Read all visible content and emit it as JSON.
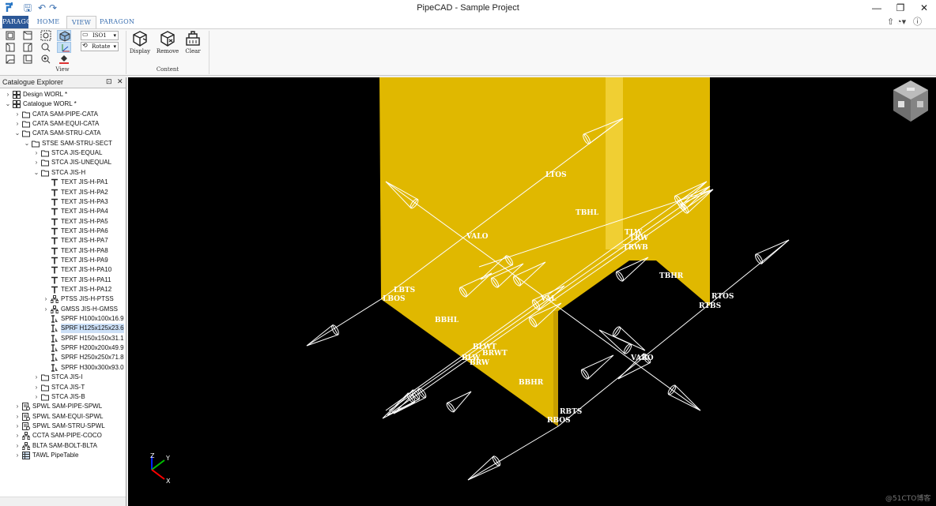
{
  "titlebar": {
    "title": "PipeCAD - Sample Project",
    "minimize": "—",
    "restore": "❐",
    "close": "✕"
  },
  "ribbon": {
    "tabs": [
      {
        "label": "PARAGON"
      },
      {
        "label": "HOME"
      },
      {
        "label": "VIEW"
      },
      {
        "label": "PARAGON"
      }
    ],
    "right_icons": [
      "up-arrow-icon",
      "palette-icon",
      "help-icon"
    ],
    "view_direction_combo": "ISO1",
    "view_mode_combo": "Rotate",
    "buttons": {
      "display": "Display",
      "remove": "Remove",
      "clear": "Clear"
    },
    "groups": {
      "view": "View",
      "content": "Content"
    }
  },
  "explorer": {
    "title": "Catalogue Explorer",
    "pin": "⊡",
    "close": "✕",
    "nodes": [
      {
        "label": "Design WORL *",
        "icon": "database-icon"
      },
      {
        "label": "Catalogue WORL *",
        "icon": "database-icon"
      },
      {
        "label": "CATA SAM-PIPE-CATA",
        "icon": "folder-icon"
      },
      {
        "label": "CATA SAM-EQUI-CATA",
        "icon": "folder-icon"
      },
      {
        "label": "CATA SAM-STRU-CATA",
        "icon": "folder-icon"
      },
      {
        "label": "STSE SAM-STRU-SECT",
        "icon": "folder-icon"
      },
      {
        "label": "STCA JIS-EQUAL",
        "icon": "folder-icon"
      },
      {
        "label": "STCA JIS-UNEQUAL",
        "icon": "folder-icon"
      },
      {
        "label": "STCA JIS-H",
        "icon": "folder-icon"
      },
      {
        "label": "TEXT JIS-H-PA1",
        "icon": "text-icon"
      },
      {
        "label": "TEXT JIS-H-PA2",
        "icon": "text-icon"
      },
      {
        "label": "TEXT JIS-H-PA3",
        "icon": "text-icon"
      },
      {
        "label": "TEXT JIS-H-PA4",
        "icon": "text-icon"
      },
      {
        "label": "TEXT JIS-H-PA5",
        "icon": "text-icon"
      },
      {
        "label": "TEXT JIS-H-PA6",
        "icon": "text-icon"
      },
      {
        "label": "TEXT JIS-H-PA7",
        "icon": "text-icon"
      },
      {
        "label": "TEXT JIS-H-PA8",
        "icon": "text-icon"
      },
      {
        "label": "TEXT JIS-H-PA9",
        "icon": "text-icon"
      },
      {
        "label": "TEXT JIS-H-PA10",
        "icon": "text-icon"
      },
      {
        "label": "TEXT JIS-H-PA11",
        "icon": "text-icon"
      },
      {
        "label": "TEXT JIS-H-PA12",
        "icon": "text-icon"
      },
      {
        "label": "PTSS JIS-H-PTSS",
        "icon": "hierarchy-icon"
      },
      {
        "label": "GMSS JIS-H-GMSS",
        "icon": "hierarchy-icon"
      },
      {
        "label": "SPRF H100x100x16.9",
        "icon": "profile-icon"
      },
      {
        "label": "SPRF H125x125x23.6",
        "icon": "profile-icon"
      },
      {
        "label": "SPRF H150x150x31.1",
        "icon": "profile-icon"
      },
      {
        "label": "SPRF H200x200x49.9",
        "icon": "profile-icon"
      },
      {
        "label": "SPRF H250x250x71.8",
        "icon": "profile-icon"
      },
      {
        "label": "SPRF H300x300x93.0",
        "icon": "profile-icon"
      },
      {
        "label": "STCA JIS-I",
        "icon": "folder-icon"
      },
      {
        "label": "STCA JIS-T",
        "icon": "folder-icon"
      },
      {
        "label": "STCA JIS-B",
        "icon": "folder-icon"
      },
      {
        "label": "SPWL SAM-PIPE-SPWL",
        "icon": "spec-icon"
      },
      {
        "label": "SPWL SAM-EQUI-SPWL",
        "icon": "spec-icon"
      },
      {
        "label": "SPWL SAM-STRU-SPWL",
        "icon": "spec-icon"
      },
      {
        "label": "CCTA SAM-PIPE-COCO",
        "icon": "hierarchy-icon"
      },
      {
        "label": "BLTA SAM-BOLT-BLTA",
        "icon": "hierarchy-icon"
      },
      {
        "label": "TAWL PipeTable",
        "icon": "table-icon"
      }
    ],
    "selected_node": "SPRF H125x125x23.6"
  },
  "viewport": {
    "background": "#000000",
    "profile_color": "#e0b800",
    "pline_labels": [
      "LTOS",
      "TBHL",
      "VALO",
      "LBTS",
      "LBOS",
      "BBHL",
      "TLW",
      "TRW",
      "TRWB",
      "TBHR",
      "RTOS",
      "RTBS",
      "VAL",
      "BLWT",
      "BRWT",
      "BLW",
      "BRW",
      "BBHR",
      "RBTS",
      "RBOS",
      "VARO"
    ],
    "axes": {
      "x": "X",
      "y": "Y",
      "z": "Z"
    },
    "watermark": "@51CTO博客"
  }
}
